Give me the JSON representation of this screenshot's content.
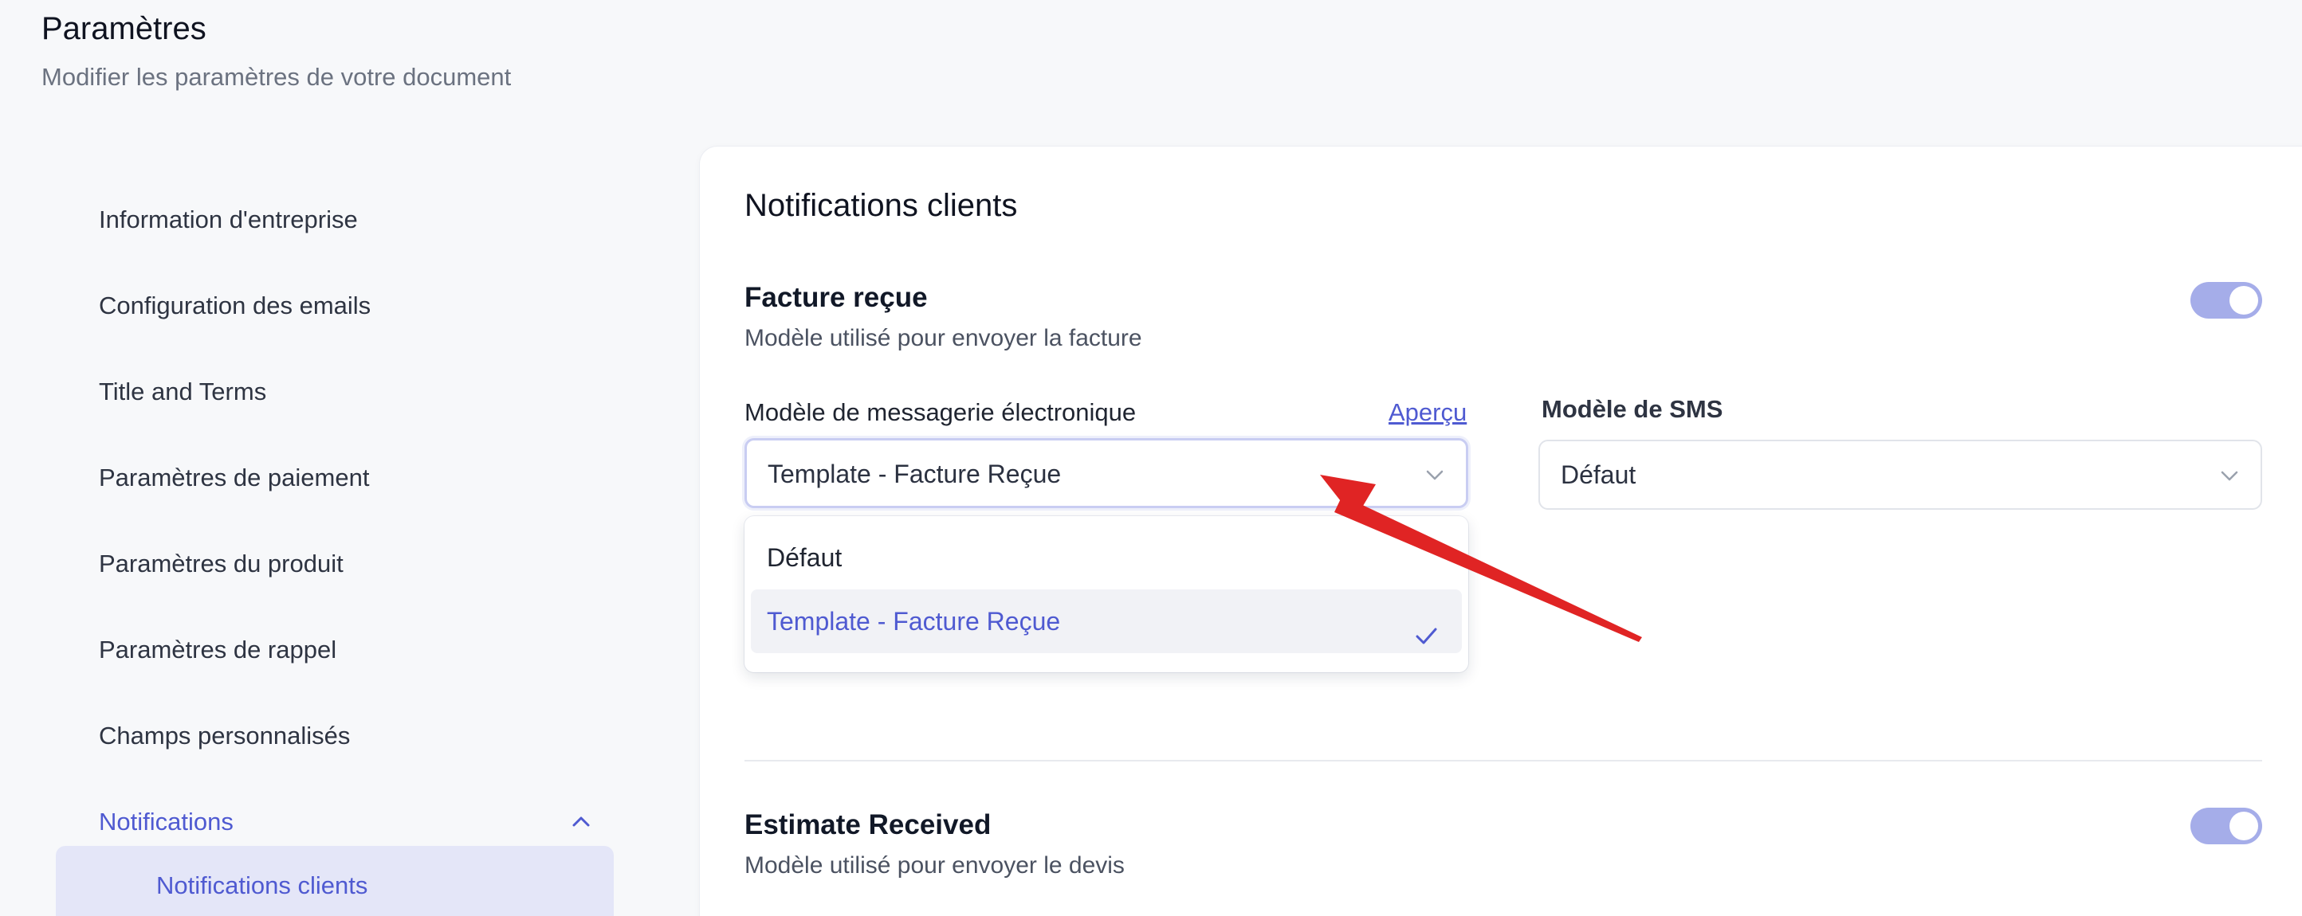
{
  "header": {
    "title": "Paramètres",
    "subtitle": "Modifier les paramètres de votre document"
  },
  "sidebar": {
    "items": [
      {
        "label": "Information d'entreprise"
      },
      {
        "label": "Configuration des emails"
      },
      {
        "label": "Title and Terms"
      },
      {
        "label": "Paramètres de paiement"
      },
      {
        "label": "Paramètres du produit"
      },
      {
        "label": "Paramètres de rappel"
      },
      {
        "label": "Champs personnalisés"
      },
      {
        "label": "Notifications",
        "expanded": true,
        "active": true
      }
    ],
    "sub_items": [
      {
        "label": "Notifications clients",
        "selected": true
      }
    ]
  },
  "card": {
    "title": "Notifications clients",
    "sections": [
      {
        "title": "Facture reçue",
        "description": "Modèle utilisé pour envoyer la facture",
        "enabled": true,
        "email_template": {
          "label": "Modèle de messagerie électronique",
          "preview_link": "Aperçu",
          "value": "Template - Facture Reçue",
          "options": [
            "Défaut",
            "Template - Facture Reçue"
          ],
          "selected_option": "Template - Facture Reçue",
          "open": true
        },
        "sms_template": {
          "label": "Modèle de SMS",
          "value": "Défaut"
        }
      },
      {
        "title": "Estimate Received",
        "description": "Modèle utilisé pour envoyer le devis",
        "enabled": true
      }
    ]
  },
  "icons": {
    "chevron_up": "chevron-up-icon",
    "chevron_down": "chevron-down-icon",
    "check": "check-icon",
    "annotation": "red-arrow-annotation"
  },
  "colors": {
    "accent": "#4f5ad1",
    "toggle_on": "#a5ade9",
    "active_sub_bg": "#e4e6f8",
    "annotation_arrow": "#e02424"
  }
}
